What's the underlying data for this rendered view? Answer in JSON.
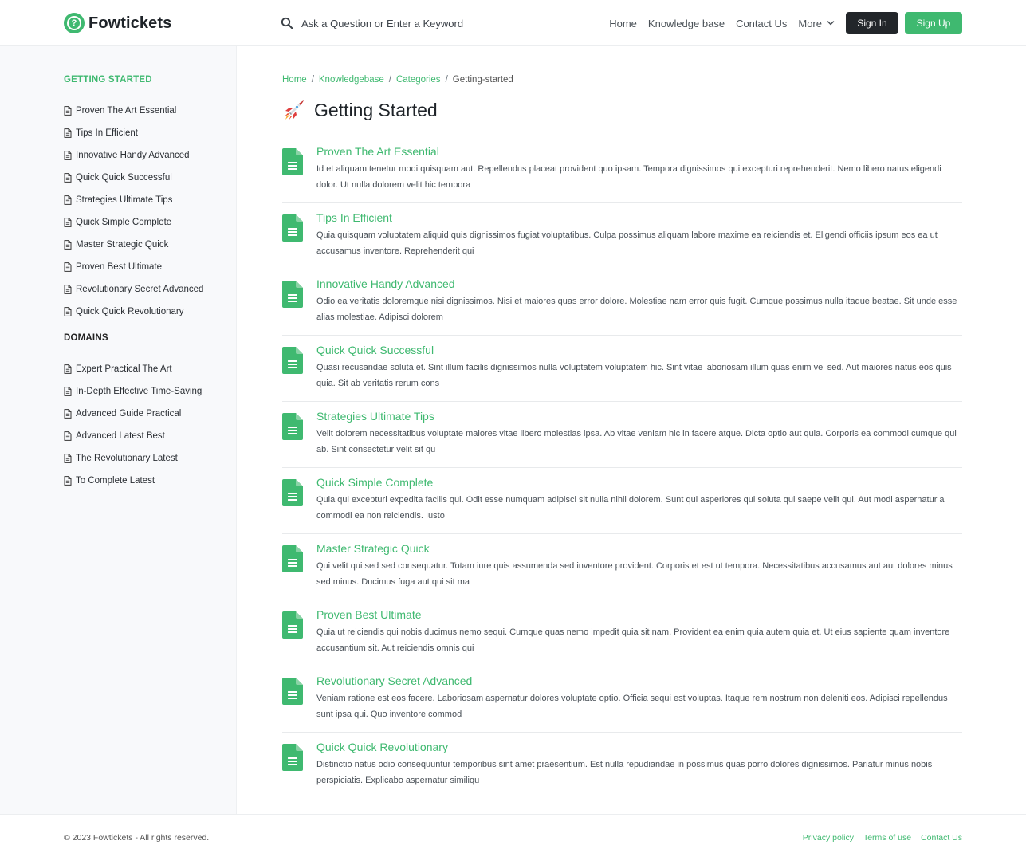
{
  "brand": {
    "name": "Fowtickets",
    "logo_glyph": "?",
    "accent_color": "#3fb970"
  },
  "search": {
    "placeholder": "Ask a Question or Enter a Keyword",
    "icon": "search-icon"
  },
  "nav": {
    "links": [
      "Home",
      "Knowledge base",
      "Contact Us"
    ],
    "more_label": "More",
    "sign_in": "Sign In",
    "sign_up": "Sign Up"
  },
  "sidebar": {
    "getting_started": {
      "title": "GETTING STARTED",
      "items": [
        "Proven The Art Essential",
        "Tips In Efficient",
        "Innovative Handy Advanced",
        "Quick Quick Successful",
        "Strategies Ultimate Tips",
        "Quick Simple Complete",
        "Master Strategic Quick",
        "Proven Best Ultimate",
        "Revolutionary Secret Advanced",
        "Quick Quick Revolutionary"
      ]
    },
    "domains": {
      "title": "DOMAINS",
      "items": [
        "Expert Practical The Art",
        "In-Depth Effective Time-Saving",
        "Advanced Guide Practical",
        "Advanced Latest Best",
        "The Revolutionary Latest",
        "To Complete Latest"
      ]
    }
  },
  "breadcrumb": {
    "items": [
      "Home",
      "Knowledgebase",
      "Categories"
    ],
    "current": "Getting-started",
    "separator": "/"
  },
  "page": {
    "title": "Getting Started",
    "icon": "rocket-icon"
  },
  "articles": [
    {
      "title": "Proven The Art Essential",
      "description": "Id et aliquam tenetur modi quisquam aut. Repellendus placeat provident quo ipsam. Tempora dignissimos qui excepturi reprehenderit. Nemo libero natus eligendi dolor. Ut nulla dolorem velit hic tempora"
    },
    {
      "title": "Tips In Efficient",
      "description": "Quia quisquam voluptatem aliquid quis dignissimos fugiat voluptatibus. Culpa possimus aliquam labore maxime ea reiciendis et. Eligendi officiis ipsum eos ea ut accusamus inventore. Reprehenderit qui"
    },
    {
      "title": "Innovative Handy Advanced",
      "description": "Odio ea veritatis doloremque nisi dignissimos. Nisi et maiores quas error dolore. Molestiae nam error quis fugit. Cumque possimus nulla itaque beatae. Sit unde esse alias molestiae. Adipisci dolorem"
    },
    {
      "title": "Quick Quick Successful",
      "description": "Quasi recusandae soluta et. Sint illum facilis dignissimos nulla voluptatem voluptatem hic. Sint vitae laboriosam illum quas enim vel sed. Aut maiores natus eos quis quia. Sit ab veritatis rerum cons"
    },
    {
      "title": "Strategies Ultimate Tips",
      "description": "Velit dolorem necessitatibus voluptate maiores vitae libero molestias ipsa. Ab vitae veniam hic in facere atque. Dicta optio aut quia. Corporis ea commodi cumque qui ab. Sint consectetur velit sit qu"
    },
    {
      "title": "Quick Simple Complete",
      "description": "Quia qui excepturi expedita facilis qui. Odit esse numquam adipisci sit nulla nihil dolorem. Sunt qui asperiores qui soluta qui saepe velit qui. Aut modi aspernatur a commodi ea non reiciendis. Iusto"
    },
    {
      "title": "Master Strategic Quick",
      "description": "Qui velit qui sed sed consequatur. Totam iure quis assumenda sed inventore provident. Corporis et est ut tempora. Necessitatibus accusamus aut aut dolores minus sed minus. Ducimus fuga aut qui sit ma"
    },
    {
      "title": "Proven Best Ultimate",
      "description": "Quia ut reiciendis qui nobis ducimus nemo sequi. Cumque quas nemo impedit quia sit nam. Provident ea enim quia autem quia et. Ut eius sapiente quam inventore accusantium sit. Aut reiciendis omnis qui"
    },
    {
      "title": "Revolutionary Secret Advanced",
      "description": "Veniam ratione est eos facere. Laboriosam aspernatur dolores voluptate optio. Officia sequi est voluptas. Itaque rem nostrum non deleniti eos. Adipisci repellendus sunt ipsa qui. Quo inventore commod"
    },
    {
      "title": "Quick Quick Revolutionary",
      "description": "Distinctio natus odio consequuntur temporibus sint amet praesentium. Est nulla repudiandae in possimus quas porro dolores dignissimos. Pariatur minus nobis perspiciatis. Explicabo aspernatur similiqu"
    }
  ],
  "footer": {
    "copyright": "© 2023 Fowtickets - All rights reserved.",
    "links": [
      "Privacy policy",
      "Terms of use",
      "Contact Us"
    ]
  }
}
